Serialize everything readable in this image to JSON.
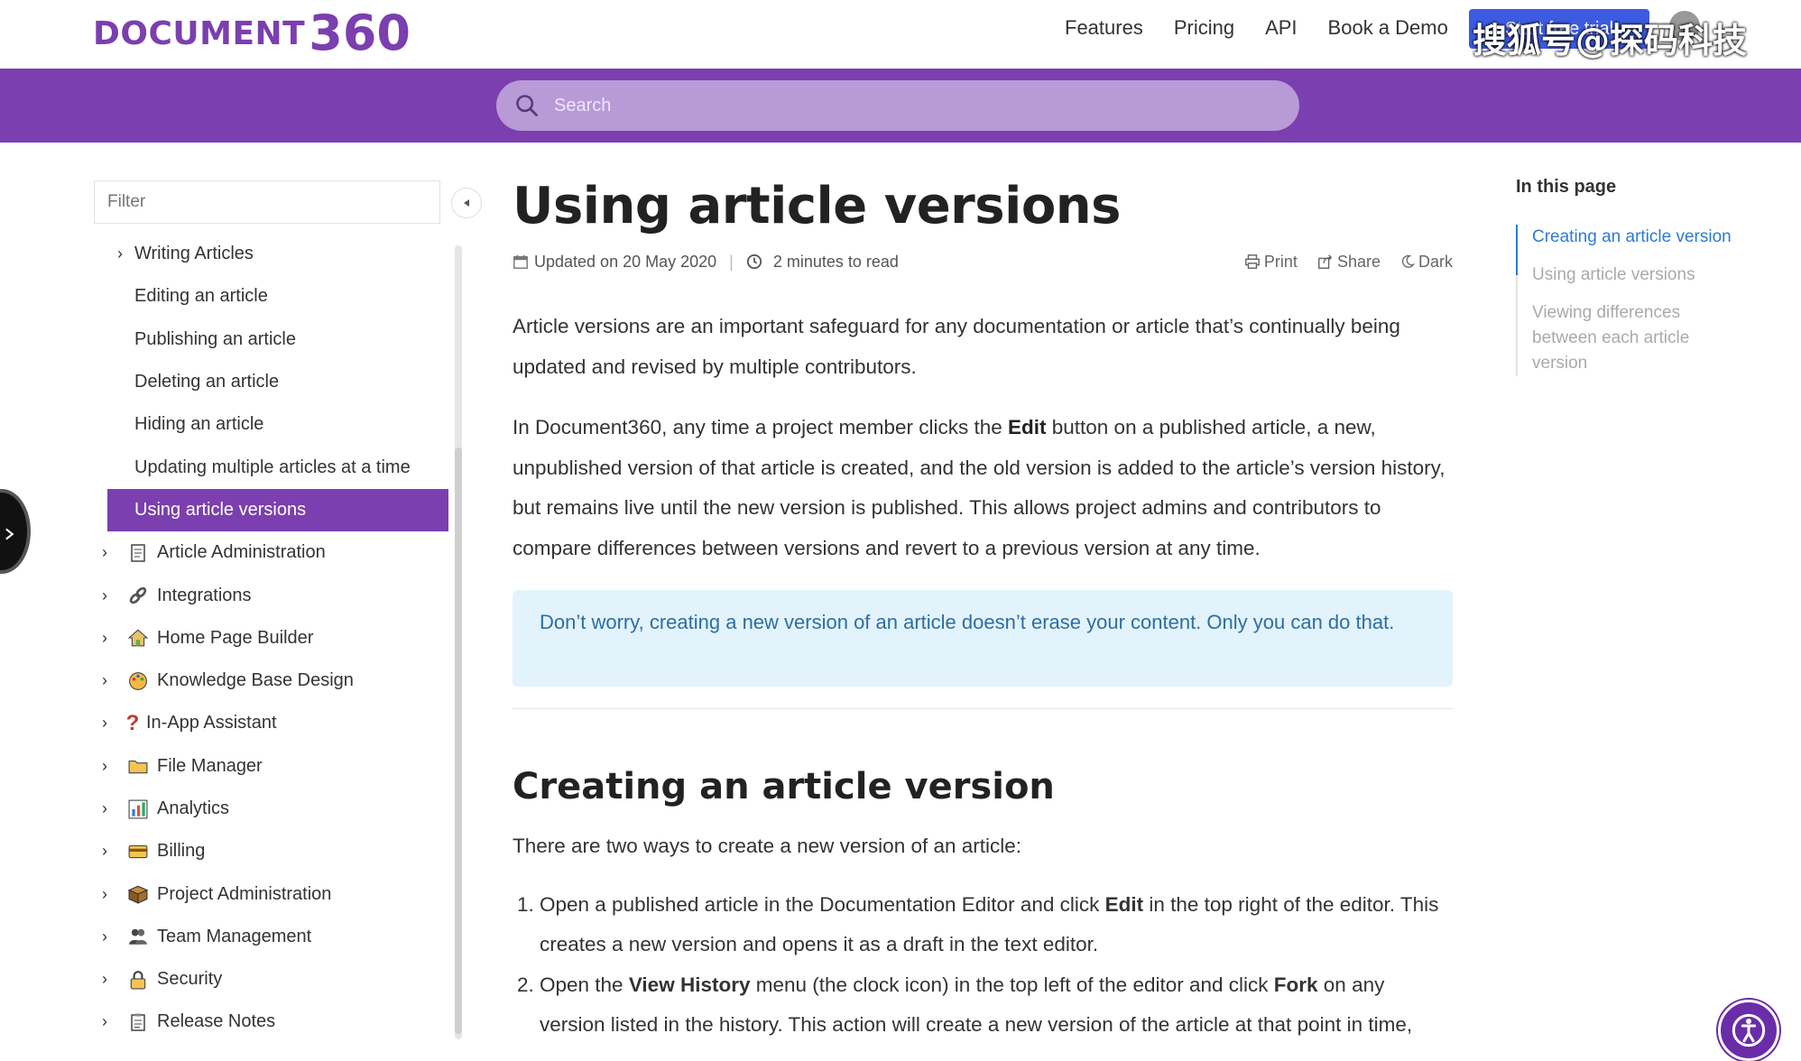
{
  "brand": {
    "logo_text": "DOCUMENT",
    "logo_num": "360"
  },
  "topnav": {
    "links": [
      "Features",
      "Pricing",
      "API",
      "Book a Demo"
    ],
    "cta_label": "Start free trial"
  },
  "watermark": "搜狐号@探码科技",
  "search": {
    "placeholder": "Search"
  },
  "sidebar": {
    "filter_placeholder": "Filter",
    "items": [
      {
        "label": "Writing Articles",
        "level": "sub",
        "chevron": true
      },
      {
        "label": "Editing an article",
        "level": "sub"
      },
      {
        "label": "Publishing an article",
        "level": "sub"
      },
      {
        "label": "Deleting an article",
        "level": "sub"
      },
      {
        "label": "Hiding an article",
        "level": "sub"
      },
      {
        "label": "Updating multiple articles at a time",
        "level": "sub"
      },
      {
        "label": "Using article versions",
        "level": "sub",
        "active": true
      },
      {
        "label": "Article Administration",
        "level": "top",
        "icon": "page-icon"
      },
      {
        "label": "Integrations",
        "level": "top",
        "icon": "link-icon"
      },
      {
        "label": "Home Page Builder",
        "level": "top",
        "icon": "house-icon"
      },
      {
        "label": "Knowledge Base Design",
        "level": "top",
        "icon": "palette-icon"
      },
      {
        "label": "In-App Assistant",
        "level": "top",
        "icon": "question-icon"
      },
      {
        "label": "File Manager",
        "level": "top",
        "icon": "folder-icon"
      },
      {
        "label": "Analytics",
        "level": "top",
        "icon": "chart-icon"
      },
      {
        "label": "Billing",
        "level": "top",
        "icon": "card-icon"
      },
      {
        "label": "Project Administration",
        "level": "top",
        "icon": "box-icon"
      },
      {
        "label": "Team Management",
        "level": "top",
        "icon": "people-icon"
      },
      {
        "label": "Security",
        "level": "top",
        "icon": "lock-icon"
      },
      {
        "label": "Release Notes",
        "level": "top",
        "icon": "notes-icon"
      }
    ]
  },
  "article": {
    "title": "Using article versions",
    "updated": "Updated on 20 May 2020",
    "read_time": "2 minutes to read",
    "actions": {
      "print": "Print",
      "share": "Share",
      "dark": "Dark"
    },
    "p1": "Article versions are an important safeguard for any documentation or article that’s continually being updated and revised by multiple contributors.",
    "p2_a": "In Document360, any time a project member clicks the ",
    "p2_b": "Edit",
    "p2_c": " button on a published article, a new, unpublished version of that article is created, and the old version is added to the article’s version history, but remains live until the new version is published. This allows project admins and contributors to compare differences between versions and revert to a previous version at any time.",
    "note": "Don’t worry, creating a new version of an article doesn’t erase your content. Only you can do that.",
    "h2": "Creating an article version",
    "p3": "There are two ways to create a new version of an article:",
    "step1_a": "Open a published article in the Documentation Editor and click ",
    "step1_b": "Edit",
    "step1_c": " in the top right of the editor. This creates a new version and opens it as a draft in the text editor.",
    "step2_a": "Open the ",
    "step2_b": "View History",
    "step2_c": " menu (the clock icon) in the top left of the editor and click ",
    "step2_d": "Fork",
    "step2_e": " on any version listed in the history. This action will create a new version of the article at that point in time,"
  },
  "toc": {
    "title": "In this page",
    "items": [
      "Creating an article version",
      "Using article versions",
      "Viewing differences between each article version"
    ]
  },
  "colors": {
    "brand_purple": "#7b3fb0",
    "link_blue": "#2b7bd5",
    "note_bg": "#e3f3fb"
  }
}
